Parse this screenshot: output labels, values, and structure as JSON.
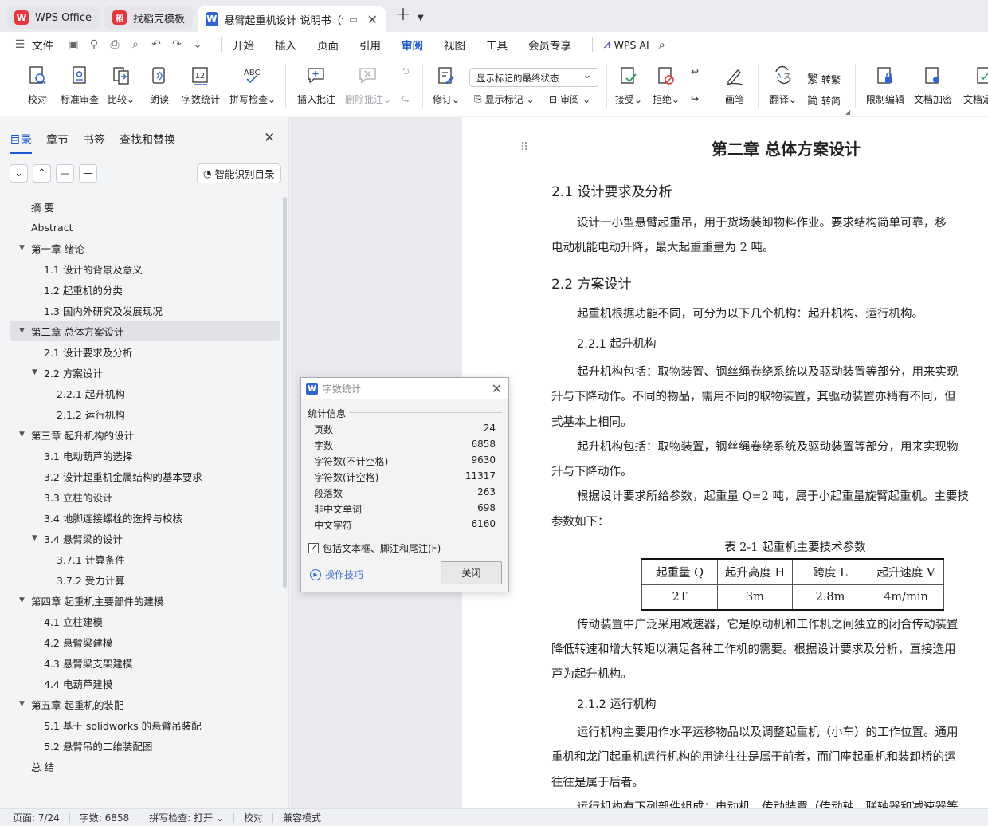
{
  "titlebar": {
    "tabs": [
      {
        "label": "WPS Office",
        "logo": "W"
      },
      {
        "label": "找稻壳模板",
        "logo": "稻"
      },
      {
        "label": "悬臂起重机设计 说明书（论文",
        "logo": "W"
      }
    ],
    "accent_color": "#1a5ad7"
  },
  "menubar": {
    "file": "文件",
    "items": [
      "开始",
      "插入",
      "页面",
      "引用",
      "审阅",
      "视图",
      "工具",
      "会员专享"
    ],
    "active": "审阅",
    "ai": "WPS AI"
  },
  "ribbon": {
    "proof": "校对",
    "std_review": "标准审查",
    "compare": "比较",
    "read_aloud": "朗读",
    "word_count": "字数统计",
    "spell_check": "拼写检查",
    "insert_comment": "插入批注",
    "delete_comment": "删除批注",
    "revise": "修订",
    "display_mode": "显示标记的最终状态",
    "show_markup": "显示标记",
    "review": "审阅",
    "accept": "接受",
    "reject": "拒绝",
    "pen": "画笔",
    "translate": "翻译",
    "to_traditional": "转繁",
    "to_simplified": "转简",
    "restrict_edit": "限制编辑",
    "doc_encrypt": "文档加密",
    "doc_finalize": "文档定"
  },
  "leftpanel": {
    "tabs": [
      "目录",
      "章节",
      "书签",
      "查找和替换"
    ],
    "smart_toc": "智能识别目录",
    "toc": [
      {
        "label": "摘 要",
        "level": 0
      },
      {
        "label": "Abstract",
        "level": 0
      },
      {
        "label": "第一章  绪论",
        "level": 0,
        "expand": true
      },
      {
        "label": "1.1 设计的背景及意义",
        "level": 1
      },
      {
        "label": "1.2 起重机的分类",
        "level": 1
      },
      {
        "label": "1.3 国内外研究及发展现况",
        "level": 1
      },
      {
        "label": "第二章  总体方案设计",
        "level": 0,
        "expand": true,
        "selected": true
      },
      {
        "label": "2.1 设计要求及分析",
        "level": 1
      },
      {
        "label": "2.2 方案设计",
        "level": 1,
        "expand": true
      },
      {
        "label": "2.2.1 起升机构",
        "level": 2
      },
      {
        "label": "2.1.2 运行机构",
        "level": 2
      },
      {
        "label": "第三章  起升机构的设计",
        "level": 0,
        "expand": true
      },
      {
        "label": "3.1 电动葫芦的选择",
        "level": 1
      },
      {
        "label": "3.2  设计起重机金属结构的基本要求",
        "level": 1
      },
      {
        "label": "3.3 立柱的设计",
        "level": 1
      },
      {
        "label": "3.4 地脚连接螺栓的选择与校核",
        "level": 1
      },
      {
        "label": "3.4 悬臂梁的设计",
        "level": 1,
        "expand": true
      },
      {
        "label": "3.7.1 计算条件",
        "level": 2
      },
      {
        "label": "3.7.2 受力计算",
        "level": 2
      },
      {
        "label": "第四章  起重机主要部件的建模",
        "level": 0,
        "expand": true
      },
      {
        "label": "4.1  立柱建模",
        "level": 1
      },
      {
        "label": "4.2  悬臂梁建模",
        "level": 1
      },
      {
        "label": "4.3  悬臂梁支架建模",
        "level": 1
      },
      {
        "label": "4.4  电葫芦建模",
        "level": 1
      },
      {
        "label": "第五章  起重机的装配",
        "level": 0,
        "expand": true
      },
      {
        "label": "5.1  基于 solidworks 的悬臂吊装配",
        "level": 1
      },
      {
        "label": "5.2  悬臂吊的二维装配图",
        "level": 1
      },
      {
        "label": "总 结",
        "level": 0
      }
    ]
  },
  "document": {
    "chapter": "第二章  总体方案设计",
    "h21": "2.1 设计要求及分析",
    "p1a": "设计一小型悬臂起重吊，用于货场装卸物料作业。要求结构简单可靠，移",
    "p1b": "电动机能电动升降，最大起重重量为 2 吨。",
    "h22": "2.2 方案设计",
    "p2": "起重机根据功能不同，可分为以下几个机构：起升机构、运行机构。",
    "h221": "2.2.1 起升机构",
    "p3a": "起升机构包括：取物装置、钢丝绳卷绕系统以及驱动装置等部分，用来实现",
    "p3b": "升与下降动作。不同的物品，需用不同的取物装置，其驱动装置亦稍有不同，但",
    "p3c": "式基本上相同。",
    "p4a": "起升机构包括：取物装置，钢丝绳卷绕系统及驱动装置等部分，用来实现物",
    "p4b": "升与下降动作。",
    "p5a": "根据设计要求所给参数，起重量 Q=2 吨，属于小起重量旋臂起重机。主要技",
    "p5b": "参数如下：",
    "table_caption": "表 2-1    起重机主要技术参数",
    "table_headers": [
      "起重量 Q",
      "起升高度 H",
      "跨度 L",
      "起升速度 V"
    ],
    "table_values": [
      "2T",
      "3m",
      "2.8m",
      "4m/min"
    ],
    "p6a": "传动装置中广泛采用减速器，它是原动机和工作机之间独立的闭合传动装置",
    "p6b": "降低转速和增大转矩以满足各种工作机的需要。根据设计要求及分析，直接选用",
    "p6c": "芦为起升机构。",
    "h212": "2.1.2 运行机构",
    "p7a": "运行机构主要用作水平运移物品以及调整起重机（小车）的工作位置。通用",
    "p7b": "重机和龙门起重机运行机构的用途往往是属于前者，而门座起重机和装卸桥的运",
    "p7c": "往往是属于后者。",
    "p8a": "运行机构有下列部件组成：电动机、传动装置（传动轴、联轴器和减速器等"
  },
  "dialog": {
    "title": "字数统计",
    "group": "统计信息",
    "stats": [
      {
        "label": "页数",
        "value": "24"
      },
      {
        "label": "字数",
        "value": "6858"
      },
      {
        "label": "字符数(不计空格)",
        "value": "9630"
      },
      {
        "label": "字符数(计空格)",
        "value": "11317"
      },
      {
        "label": "段落数",
        "value": "263"
      },
      {
        "label": "非中文单词",
        "value": "698"
      },
      {
        "label": "中文字符",
        "value": "6160"
      }
    ],
    "checkbox": "包括文本框、脚注和尾注(F)",
    "tip": "操作技巧",
    "close": "关闭"
  },
  "statusbar": {
    "page": "页面: 7/24",
    "words": "字数: 6858",
    "spell": "拼写检查: 打开",
    "proof": "校对",
    "compat": "兼容模式"
  }
}
